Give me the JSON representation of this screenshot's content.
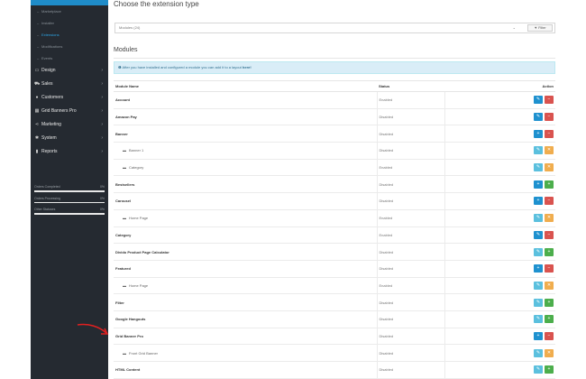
{
  "sidebar": {
    "submenu": [
      {
        "label": "Extensions",
        "active": true
      },
      {
        "label": "Marketplace"
      },
      {
        "label": "Installer"
      },
      {
        "label": "Extensions",
        "active": true
      },
      {
        "label": "Modifications"
      },
      {
        "label": "Events"
      }
    ],
    "nav": [
      {
        "label": "Design",
        "icon": "desktop-icon"
      },
      {
        "label": "Sales",
        "icon": "cart-icon"
      },
      {
        "label": "Customers",
        "icon": "user-icon"
      },
      {
        "label": "Grid Banners Pro",
        "icon": "grid-icon"
      },
      {
        "label": "Marketing",
        "icon": "share-icon"
      },
      {
        "label": "System",
        "icon": "gear-icon"
      },
      {
        "label": "Reports",
        "icon": "bar-chart-icon"
      }
    ],
    "stats": [
      {
        "label": "Orders Completed",
        "value": "0%"
      },
      {
        "label": "Orders Processing",
        "value": "0%"
      },
      {
        "label": "Other Statuses",
        "value": "0%"
      }
    ]
  },
  "main": {
    "title": "Choose the extension type",
    "type_select": "Modules (24)",
    "filter_button": "Filter",
    "section_title": "Modules",
    "info_text": "After you have installed and configured a module you can add it to a layout",
    "info_link": "here!",
    "columns": {
      "name": "Module Name",
      "status": "Status",
      "action": "Action"
    }
  },
  "rows": [
    {
      "name": "Account",
      "status": "Enabled",
      "type": "module",
      "buttons": [
        "edit-blue",
        "uninstall-red"
      ]
    },
    {
      "name": "Amazon Pay",
      "status": "Disabled",
      "type": "module",
      "buttons": [
        "edit-blue",
        "uninstall-red"
      ]
    },
    {
      "name": "Banner",
      "status": "Disabled",
      "type": "module",
      "buttons": [
        "add-blue",
        "uninstall-red"
      ]
    },
    {
      "name": "Banner 1",
      "status": "Disabled",
      "type": "child",
      "buttons": [
        "edit-lightblue",
        "delete-orange"
      ]
    },
    {
      "name": "Category",
      "status": "Enabled",
      "type": "child",
      "buttons": [
        "edit-lightblue",
        "delete-orange"
      ]
    },
    {
      "name": "Bestsellers",
      "status": "Disabled",
      "type": "module",
      "buttons": [
        "add-blue",
        "install-green"
      ]
    },
    {
      "name": "Carousel",
      "status": "Disabled",
      "type": "module",
      "buttons": [
        "add-blue",
        "uninstall-red"
      ]
    },
    {
      "name": "Home Page",
      "status": "Enabled",
      "type": "child",
      "buttons": [
        "edit-lightblue",
        "delete-orange"
      ]
    },
    {
      "name": "Category",
      "status": "Enabled",
      "type": "module",
      "buttons": [
        "edit-blue",
        "uninstall-red"
      ]
    },
    {
      "name": "Divido Product Page Calculator",
      "status": "Disabled",
      "type": "module",
      "buttons": [
        "edit-lightblue",
        "install-green"
      ]
    },
    {
      "name": "Featured",
      "status": "Disabled",
      "type": "module",
      "buttons": [
        "add-blue",
        "uninstall-red"
      ]
    },
    {
      "name": "Home Page",
      "status": "Enabled",
      "type": "child",
      "buttons": [
        "edit-lightblue",
        "delete-orange"
      ]
    },
    {
      "name": "Filter",
      "status": "Disabled",
      "type": "module",
      "buttons": [
        "edit-lightblue",
        "install-green"
      ]
    },
    {
      "name": "Google Hangouts",
      "status": "Disabled",
      "type": "module",
      "buttons": [
        "edit-lightblue",
        "install-green"
      ]
    },
    {
      "name": "Grid Banner Pro",
      "status": "Disabled",
      "type": "module",
      "buttons": [
        "add-blue",
        "uninstall-red"
      ]
    },
    {
      "name": "Front Grid Banner",
      "status": "Disabled",
      "type": "child",
      "buttons": [
        "edit-lightblue",
        "delete-orange"
      ]
    },
    {
      "name": "HTML Content",
      "status": "Disabled",
      "type": "module",
      "buttons": [
        "edit-lightblue",
        "install-green"
      ]
    }
  ],
  "colors": {
    "primary": "#1e91cf",
    "danger": "#d9534f",
    "success": "#4cae4c",
    "warning": "#f0ad4e",
    "info": "#5bc0de",
    "sidebar": "#252a31",
    "annotation": "#e02020"
  }
}
